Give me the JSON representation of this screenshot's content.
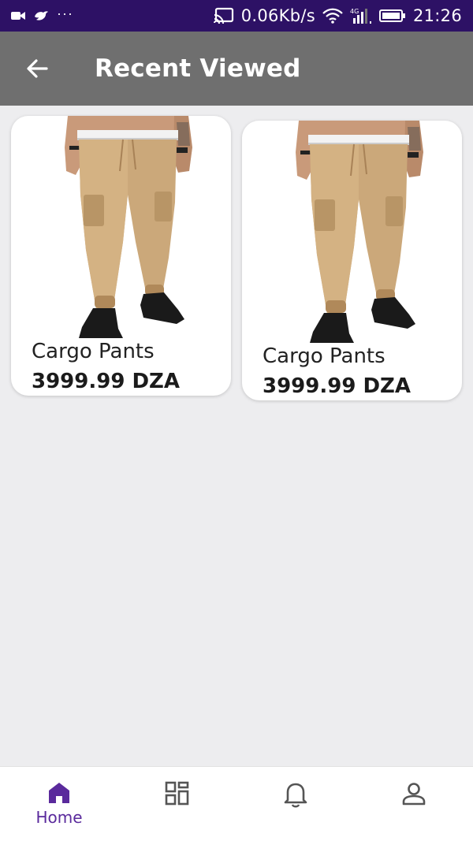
{
  "status_bar": {
    "notification_dots": "···",
    "network_speed": "0.06Kb/s",
    "time": "21:26",
    "icons": [
      "video-icon",
      "bird-icon",
      "cast-icon",
      "wifi-icon",
      "signal-4g-icon",
      "battery-icon"
    ]
  },
  "app_bar": {
    "title": "Recent Viewed",
    "back_icon": "arrow-back-icon"
  },
  "products": [
    {
      "name": "Cargo Pants",
      "price": "3999.99 DZA",
      "image": "khaki-cargo-pants-photo"
    },
    {
      "name": "Cargo Pants",
      "price": "3999.99 DZA",
      "image": "khaki-cargo-pants-photo"
    }
  ],
  "bottom_nav": {
    "items": [
      {
        "label": "Home",
        "icon": "home-icon",
        "active": true
      },
      {
        "label": "",
        "icon": "grid-icon",
        "active": false
      },
      {
        "label": "",
        "icon": "bell-icon",
        "active": false
      },
      {
        "label": "",
        "icon": "person-icon",
        "active": false
      }
    ]
  },
  "colors": {
    "status_bar": "#2d1165",
    "app_bar": "#6f6f6f",
    "background": "#ededef",
    "accent": "#5a2a9c",
    "nav_icon_inactive": "#555555"
  }
}
